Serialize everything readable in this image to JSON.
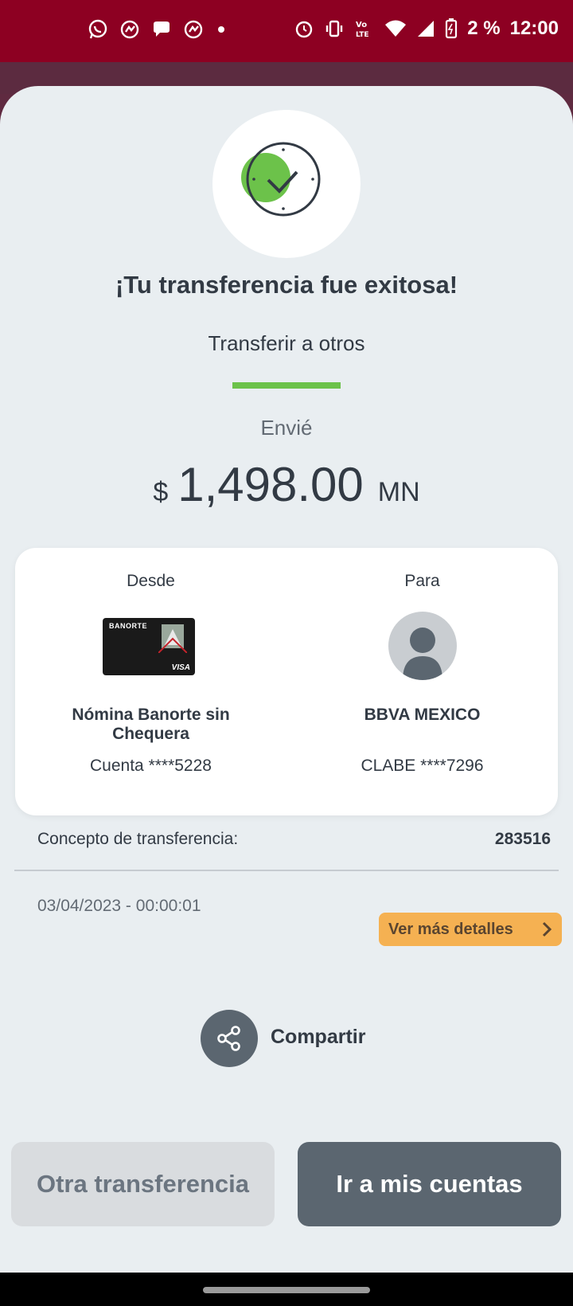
{
  "status_bar": {
    "battery": "2 %",
    "time": "12:00",
    "icons_left": [
      "whatsapp-icon",
      "messenger-icon",
      "chat-bubble-icon",
      "messenger-icon",
      "dot-icon"
    ],
    "icons_right": [
      "alarm-icon",
      "vibrate-icon",
      "volte-icon",
      "wifi-icon",
      "signal-icon",
      "battery-icon"
    ]
  },
  "result": {
    "title": "¡Tu transferencia fue exitosa!",
    "subtitle": "Transferir a otros",
    "sent_label": "Envié",
    "amount_currency": "$",
    "amount_value": "1,498.00",
    "amount_suffix": "MN"
  },
  "from": {
    "label": "Desde",
    "card_brand": "BANORTE",
    "card_network": "VISA",
    "name": "Nómina Banorte sin Chequera",
    "account": "Cuenta ****5228"
  },
  "to": {
    "label": "Para",
    "name": "BBVA MEXICO",
    "account": "CLABE ****7296"
  },
  "details": {
    "concept_label": "Concepto de transferencia:",
    "concept_value": "283516",
    "datetime": "03/04/2023 - 00:00:01",
    "more_details_label": "Ver más detalles"
  },
  "share": {
    "label": "Compartir"
  },
  "actions": {
    "other_transfer_label": "Otra transferencia",
    "my_accounts_label": "Ir a mis cuentas"
  },
  "colors": {
    "status_bar": "#8d0022",
    "accent_green": "#6cc24a",
    "details_button": "#f5b152",
    "primary_button": "#5b6670",
    "text": "#323a44"
  }
}
